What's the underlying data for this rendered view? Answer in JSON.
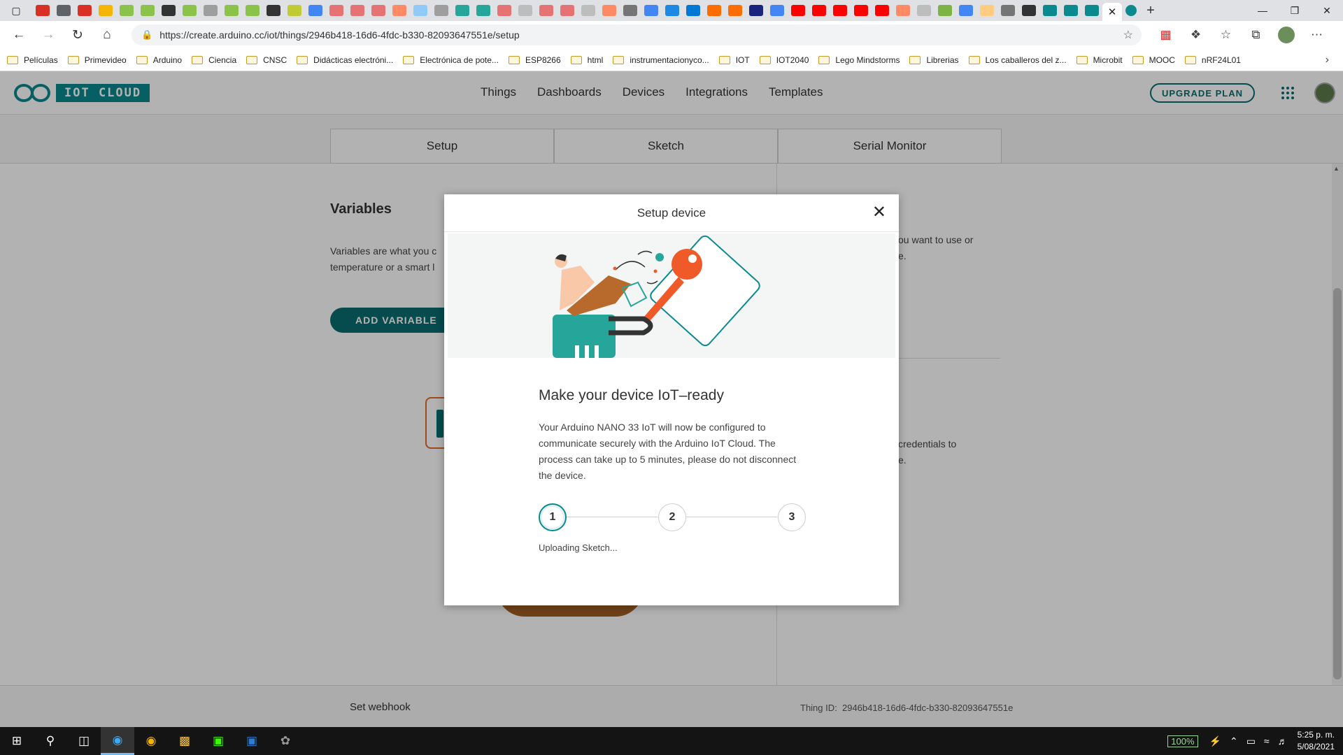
{
  "browser": {
    "url": "https://create.arduino.cc/iot/things/2946b418-16d6-4fdc-b330-82093647551e/setup",
    "bookmarks": [
      "Películas",
      "Primevideo",
      "Arduino",
      "Ciencia",
      "CNSC",
      "Didácticas electróni...",
      "Electrónica de pote...",
      "ESP8266",
      "html",
      "instrumentacionyco...",
      "IOT",
      "IOT2040",
      "Lego Mindstorms",
      "Librerias",
      "Los caballeros del z...",
      "Microbit",
      "MOOC",
      "nRF24L01"
    ],
    "tab_favicon_colors": [
      "#d93025",
      "#5f6368",
      "#d93025",
      "#f4b400",
      "#8bc34a",
      "#8bc34a",
      "#333333",
      "#8bc34a",
      "#9e9e9e",
      "#8bc34a",
      "#8bc34a",
      "#333333",
      "#c0ca33",
      "#4285f4",
      "#e57373",
      "#e57373",
      "#e57373",
      "#ff8a65",
      "#90caf9",
      "#9e9e9e",
      "#26a69a",
      "#26a69a",
      "#e57373",
      "#bdbdbd",
      "#e57373",
      "#e57373",
      "#bdbdbd",
      "#ff8a65",
      "#757575",
      "#4285f4",
      "#1e88e5",
      "#0078d4",
      "#ff6d00",
      "#ff6d00",
      "#1a237e",
      "#4285f4",
      "#ff0000",
      "#ff0000",
      "#ff0000",
      "#ff0000",
      "#ff0000",
      "#ff8a65",
      "#bdbdbd",
      "#7cb342",
      "#4285f4",
      "#ffcc80",
      "#757575",
      "#333333",
      "#0a8a8f",
      "#0a8a8f",
      "#0a8a8f"
    ]
  },
  "app": {
    "logo_text": "IOT CLOUD",
    "nav": [
      "Things",
      "Dashboards",
      "Devices",
      "Integrations",
      "Templates"
    ],
    "upgrade_label": "UPGRADE PLAN",
    "tabs": [
      "Setup",
      "Sketch",
      "Serial Monitor"
    ],
    "variables_title": "Variables",
    "variables_desc_line1": "Variables are what you c",
    "variables_desc_line2": "temperature or a smart l",
    "add_variable_label": "ADD VARIABLE",
    "right_text_1_line1": "ou want to use or",
    "right_text_1_line2": "e.",
    "right_text_2_line1": "credentials to",
    "right_text_2_line2": "e.",
    "webhook_label": "Set webhook",
    "thing_id_label": "Thing ID:",
    "thing_id_value": "2946b418-16d6-4fdc-b330-82093647551e"
  },
  "modal": {
    "title": "Setup device",
    "heading": "Make your device IoT–ready",
    "body": "Your Arduino NANO 33 IoT will now be configured to communicate securely with the Arduino IoT Cloud. The process can take up to 5 minutes, please do not disconnect the device.",
    "steps": [
      "1",
      "2",
      "3"
    ],
    "active_step": 1,
    "status": "Uploading Sketch..."
  },
  "taskbar": {
    "battery": "100%",
    "time": "5:25 p. m.",
    "date": "5/08/2021"
  },
  "colors": {
    "accent": "#0a8a8f",
    "accent_dark": "#0a6e72",
    "key_orange": "#f05a28"
  }
}
